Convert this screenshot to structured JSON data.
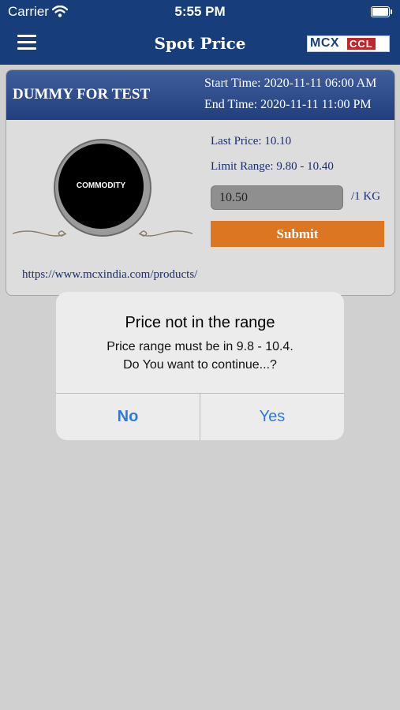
{
  "status_bar": {
    "carrier": "Carrier",
    "time": "5:55 PM"
  },
  "header": {
    "title": "Spot Price",
    "logo": {
      "part1": "MCX",
      "part2": "CCL"
    }
  },
  "card": {
    "name": "DUMMY FOR TEST",
    "start_time": "Start Time: 2020-11-11 06:00 AM",
    "end_time": "End Time: 2020-11-11 11:00 PM",
    "image_label": "COMMODITY",
    "last_price": "Last Price: 10.10",
    "limit_range": "Limit Range: 9.80 - 10.40",
    "price_value": "10.50",
    "unit": "/1 KG",
    "submit_label": "Submit",
    "url": "https://www.mcxindia.com/products/"
  },
  "alert": {
    "title": "Price not in the range",
    "message_line1": "Price range must be in 9.8 - 10.4.",
    "message_line2": "Do You want to continue...?",
    "no_label": "No",
    "yes_label": "Yes"
  },
  "colors": {
    "header_bg": "#173d7a",
    "submit_bg": "#dd7623",
    "alert_button": "#2f78d9",
    "background": "#d0d0d0"
  }
}
